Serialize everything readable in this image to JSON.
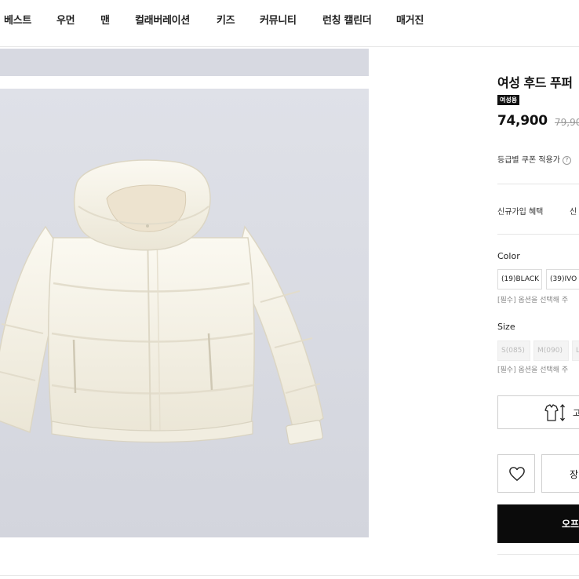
{
  "nav": {
    "items": [
      "베스트",
      "우먼",
      "맨",
      "컬래버레이션",
      "키즈",
      "커뮤니티",
      "런칭 캘린더",
      "매거진"
    ]
  },
  "product": {
    "title": "여성 후드 푸퍼",
    "badge": "여성용",
    "price": "74,900",
    "original_price": "79,90",
    "coupon_label": "등급별 쿠폰 적용가",
    "help_icon_text": "?",
    "benefit_label": "신규가입 혜택",
    "benefit_value": "신",
    "image_alt_icon": "puffer-jacket-image"
  },
  "color": {
    "label": "Color",
    "options": [
      "(19)BLACK",
      "(39)IVO"
    ],
    "required_text": "[필수] 옵션을 선택해 주"
  },
  "size": {
    "label": "Size",
    "options": [
      "S(085)",
      "M(090)",
      "L"
    ],
    "required_text": "[필수] 옵션을 선택해 주"
  },
  "actions": {
    "size_guide_label": "고",
    "cart_label": "장",
    "buy_label": "오프"
  },
  "colors": {
    "accent": "#0b0b0b",
    "jacket": "#f6f3e8",
    "background": "#d9dbe3"
  },
  "icons": {
    "size_guide": "shirt-ruler-icon",
    "wishlist": "heart-icon"
  }
}
